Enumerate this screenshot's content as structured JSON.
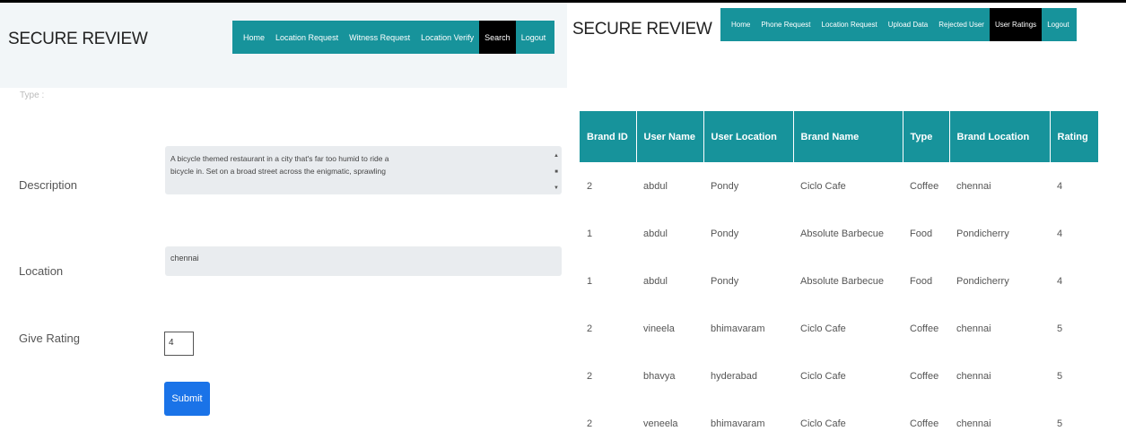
{
  "left": {
    "brand": "SECURE REVIEW",
    "nav": [
      "Home",
      "Location Request",
      "Witness Request",
      "Location Verify",
      "Search",
      "Logout"
    ],
    "nav_active": "Search",
    "faded_label": "Type :",
    "form": {
      "description_label": "Description",
      "description_lines": [
        "A bicycle themed restaurant in a city that's far too humid to ride a",
        "bicycle in. Set on a broad street across the enigmatic, sprawling"
      ],
      "location_label": "Location",
      "location_value": "chennai",
      "rating_label": "Give Rating",
      "rating_value": "4",
      "submit_label": "Submit"
    }
  },
  "right": {
    "brand": "SECURE REVIEW",
    "nav": [
      "Home",
      "Phone Request",
      "Location Request",
      "Upload Data",
      "Rejected User",
      "User Ratings",
      "Logout"
    ],
    "nav_active": "User Ratings",
    "table": {
      "headers": [
        "Brand ID",
        "User Name",
        "User Location",
        "Brand Name",
        "Type",
        "Brand Location",
        "Rating"
      ],
      "rows": [
        [
          "2",
          "abdul",
          "Pondy",
          "Ciclo Cafe",
          "Coffee",
          "chennai",
          "4"
        ],
        [
          "1",
          "abdul",
          "Pondy",
          "Absolute Barbecue",
          "Food",
          "Pondicherry",
          "4"
        ],
        [
          "1",
          "abdul",
          "Pondy",
          "Absolute Barbecue",
          "Food",
          "Pondicherry",
          "4"
        ],
        [
          "2",
          "vineela",
          "bhimavaram",
          "Ciclo Cafe",
          "Coffee",
          "chennai",
          "5"
        ],
        [
          "2",
          "bhavya",
          "hyderabad",
          "Ciclo Cafe",
          "Coffee",
          "chennai",
          "5"
        ],
        [
          "2",
          "veneela",
          "bhimavaram",
          "Ciclo Cafe",
          "Coffee",
          "chennai",
          "5"
        ]
      ]
    }
  },
  "colors": {
    "teal": "#17939b",
    "active_nav": "#000000",
    "submit": "#1a73e8",
    "header_bg": "#f2f6f8",
    "field_bg": "#e9ecef"
  }
}
